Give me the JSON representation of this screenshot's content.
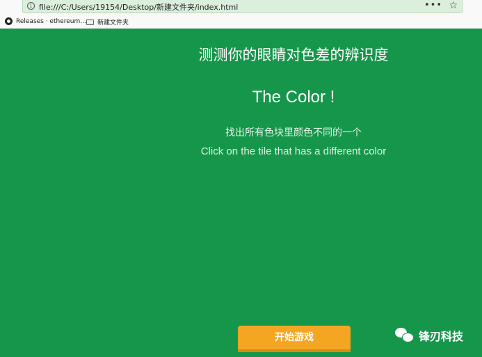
{
  "browser": {
    "url": "file:///C:/Users/19154/Desktop/新建文件夹/index.html",
    "more_glyph": "•••",
    "star_glyph": "☆",
    "bookmarks": [
      {
        "label": "Releases · ethereum...",
        "icon": "github-icon"
      },
      {
        "label": "新建文件夹",
        "icon": "folder-icon"
      }
    ]
  },
  "page": {
    "background": "#16964b",
    "title_cn": "测测你的眼睛对色差的辨识度",
    "title_en": "The Color !",
    "instruction_cn": "找出所有色块里颜色不同的一个",
    "instruction_en": "Click on the tile that has a different color",
    "start_button": "开始游戏",
    "start_button_color": "#f4a623"
  },
  "watermark": {
    "text": "锋刃科技",
    "icon": "wechat-icon"
  }
}
